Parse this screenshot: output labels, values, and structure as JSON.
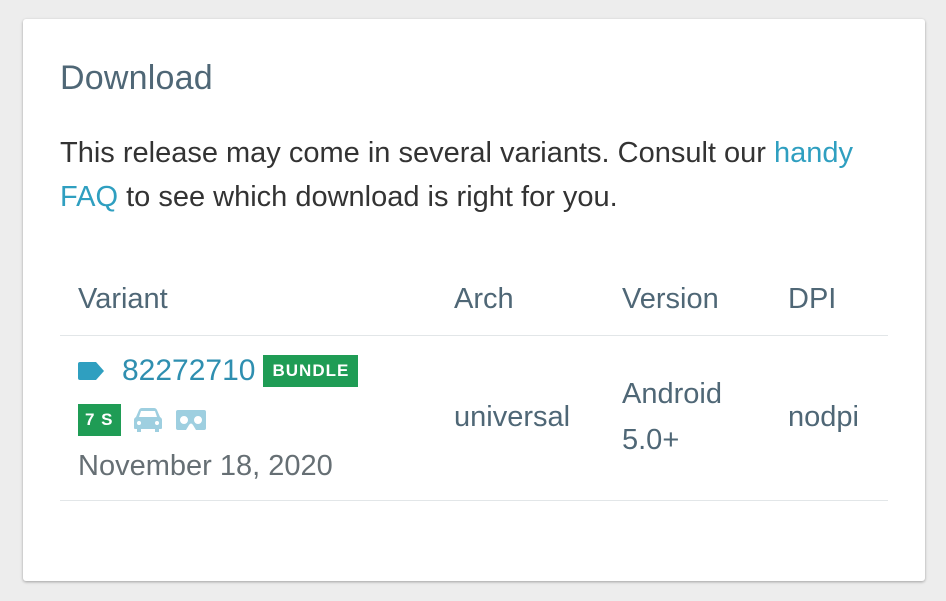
{
  "card": {
    "title": "Download",
    "description_before": "This release may come in several variants. Consult our ",
    "faq_link": "handy FAQ",
    "description_after": " to see which download is right for you."
  },
  "table": {
    "headers": {
      "variant": "Variant",
      "arch": "Arch",
      "version": "Version",
      "dpi": "DPI"
    },
    "rows": [
      {
        "variant_id": "82272710",
        "bundle_badge": "BUNDLE",
        "sdk_badge": "7 S",
        "icons": [
          "tag-icon",
          "car-icon",
          "vr-headset-icon"
        ],
        "date": "November 18, 2020",
        "arch": "universal",
        "version_line1": "Android",
        "version_line2": "5.0+",
        "dpi": "nodpi"
      }
    ]
  },
  "colors": {
    "link": "#2f9fc0",
    "heading": "#4f6776",
    "badge": "#1f9c55",
    "icon_light": "#9ecfe0",
    "tag_icon": "#2f9fc0"
  }
}
